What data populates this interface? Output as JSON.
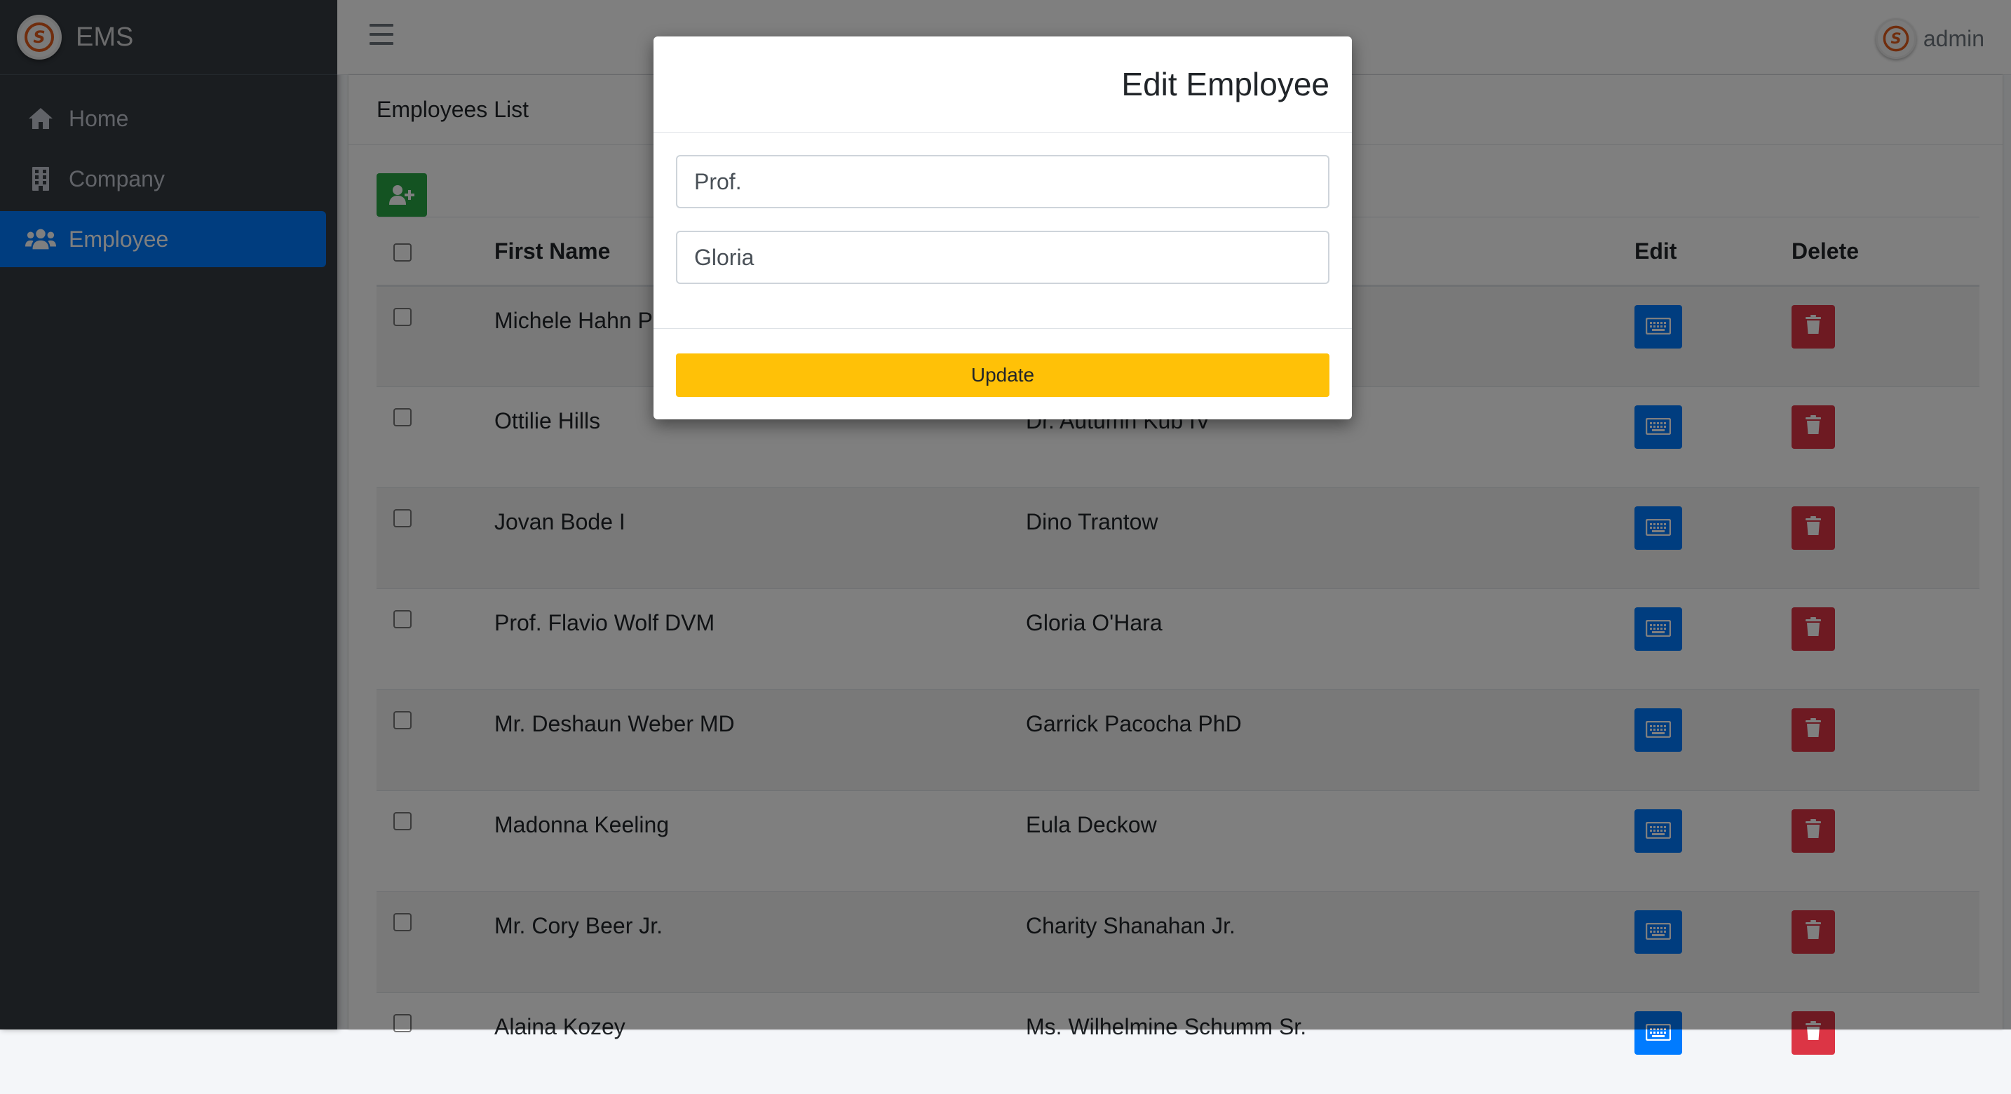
{
  "app": {
    "brand": "EMS"
  },
  "sidebar": {
    "items": [
      {
        "label": "Home",
        "icon": "home-icon"
      },
      {
        "label": "Company",
        "icon": "building-icon"
      },
      {
        "label": "Employee",
        "icon": "users-icon",
        "active": true
      }
    ]
  },
  "topbar": {
    "user": "admin"
  },
  "card": {
    "title": "Employees List"
  },
  "table": {
    "headers": {
      "first_name": "First Name",
      "last_name": "",
      "edit": "Edit",
      "delete": "Delete"
    },
    "rows": [
      {
        "first": "Michele Hahn P",
        "last": ""
      },
      {
        "first": "Ottilie Hills",
        "last": "Dr. Autumn Kub IV"
      },
      {
        "first": "Jovan Bode I",
        "last": "Dino Trantow"
      },
      {
        "first": "Prof. Flavio Wolf DVM",
        "last": "Gloria O'Hara"
      },
      {
        "first": "Mr. Deshaun Weber MD",
        "last": "Garrick Pacocha PhD"
      },
      {
        "first": "Madonna Keeling",
        "last": "Eula Deckow"
      },
      {
        "first": "Mr. Cory Beer Jr.",
        "last": "Charity Shanahan Jr."
      },
      {
        "first": "Alaina Kozey",
        "last": "Ms. Wilhelmine Schumm Sr."
      }
    ]
  },
  "modal": {
    "title": "Edit Employee",
    "field1_value": "Prof.",
    "field2_value": "Gloria",
    "update_label": "Update"
  },
  "colors": {
    "sidebar_bg": "#343a40",
    "active_blue": "#007bff",
    "success_green": "#28a745",
    "danger_red": "#dc3545",
    "warning_yellow": "#ffc107"
  }
}
